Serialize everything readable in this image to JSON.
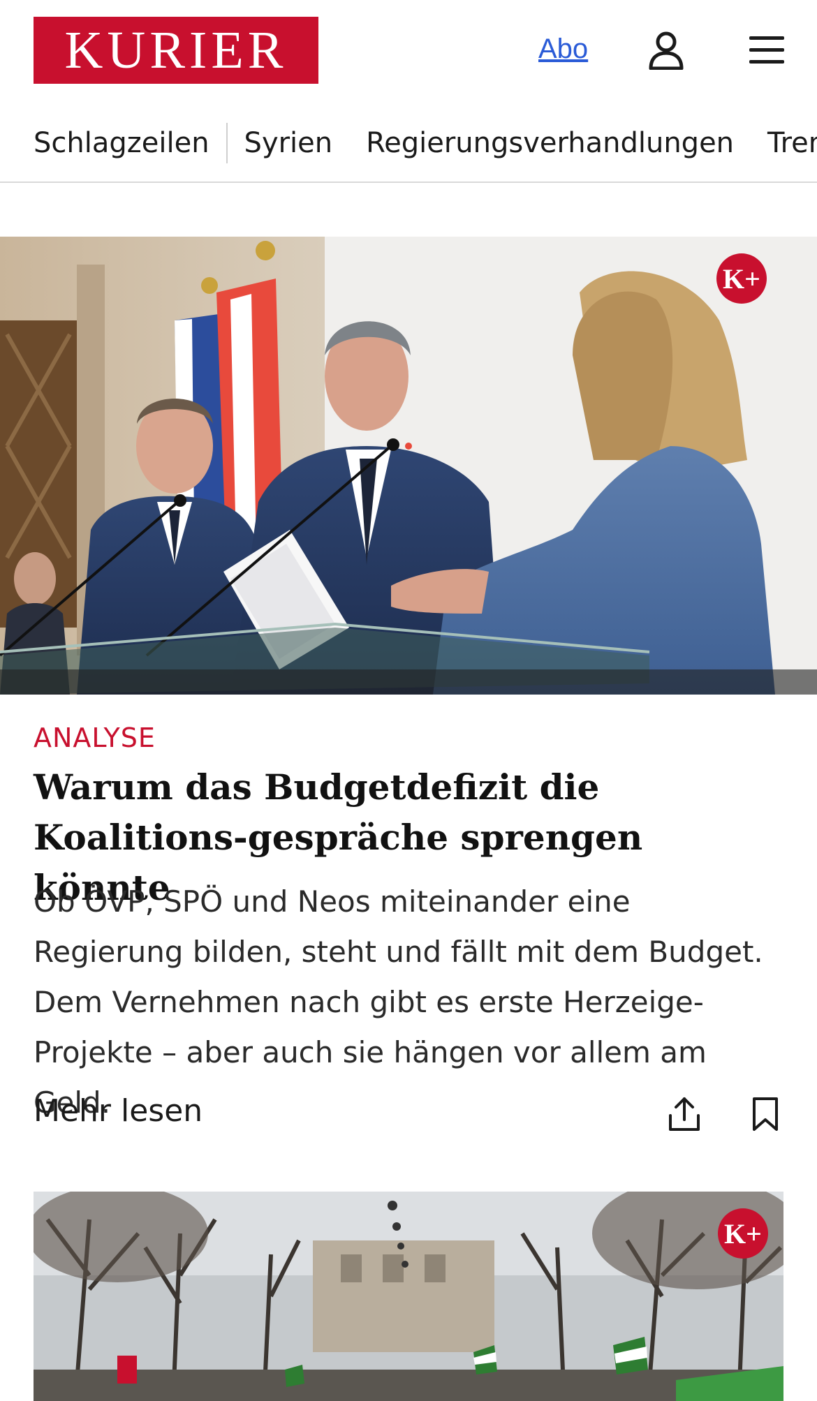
{
  "header": {
    "logo_text": "KURIER",
    "abo_label": "Abo",
    "brand_color": "#c8102e",
    "link_color": "#2a5bd7",
    "icons": [
      "user-icon",
      "menu-icon"
    ]
  },
  "nav": {
    "items": [
      {
        "label": "Schlagzeilen"
      },
      {
        "label": "Syrien"
      },
      {
        "label": "Regierungsverhandlungen"
      },
      {
        "label": "Trend"
      }
    ]
  },
  "articles": [
    {
      "badge": "K+",
      "kicker": "ANALYSE",
      "headline": "Warum das Budgetdefizit die Koalitions-gespräche sprengen könnte",
      "teaser": "Ob ÖVP, SPÖ und Neos miteinander eine Regierung bilden, steht und fällt mit dem Budget. Dem Vernehmen nach gibt es erste Herzeige-Projekte – aber auch sie hängen vor allem am Geld.",
      "more_label": "Mehr lesen",
      "actions": [
        "share-icon",
        "bookmark-icon"
      ]
    },
    {
      "badge": "K+"
    }
  ]
}
